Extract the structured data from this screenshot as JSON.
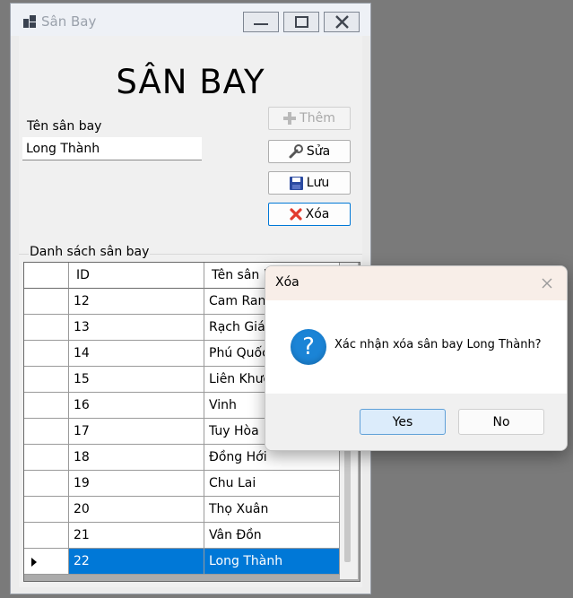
{
  "window": {
    "title": "Sân Bay"
  },
  "form": {
    "heading": "SÂN BAY",
    "name_label": "Tên sân bay",
    "name_value": "Long Thành"
  },
  "buttons": {
    "add": "Thêm",
    "edit": "Sửa",
    "save": "Lưu",
    "delete": "Xóa"
  },
  "list": {
    "group_label": "Danh sách sân bay",
    "columns": [
      "ID",
      "Tên sân bay"
    ],
    "rows": [
      {
        "id": "12",
        "name": "Cam Ranh"
      },
      {
        "id": "13",
        "name": "Rạch Giá"
      },
      {
        "id": "14",
        "name": "Phú Quốc"
      },
      {
        "id": "15",
        "name": "Liên Khương"
      },
      {
        "id": "16",
        "name": "Vinh"
      },
      {
        "id": "17",
        "name": "Tuy Hòa"
      },
      {
        "id": "18",
        "name": "Đồng Hới"
      },
      {
        "id": "19",
        "name": "Chu Lai"
      },
      {
        "id": "20",
        "name": "Thọ Xuân"
      },
      {
        "id": "21",
        "name": "Vân Đồn"
      },
      {
        "id": "22",
        "name": "Long Thành"
      }
    ],
    "selected_id": "22"
  },
  "dialog": {
    "title": "Xóa",
    "message": "Xác nhận xóa sân bay Long Thành?",
    "yes": "Yes",
    "no": "No"
  },
  "colors": {
    "selection": "#0078d7",
    "question_icon": "#1b84d6",
    "delete_icon": "#e23b2e"
  },
  "icons": {
    "add": "plus-icon",
    "edit": "wrench-icon",
    "save": "floppy-disk-icon",
    "delete": "red-x-icon",
    "dialog": "question-icon"
  }
}
